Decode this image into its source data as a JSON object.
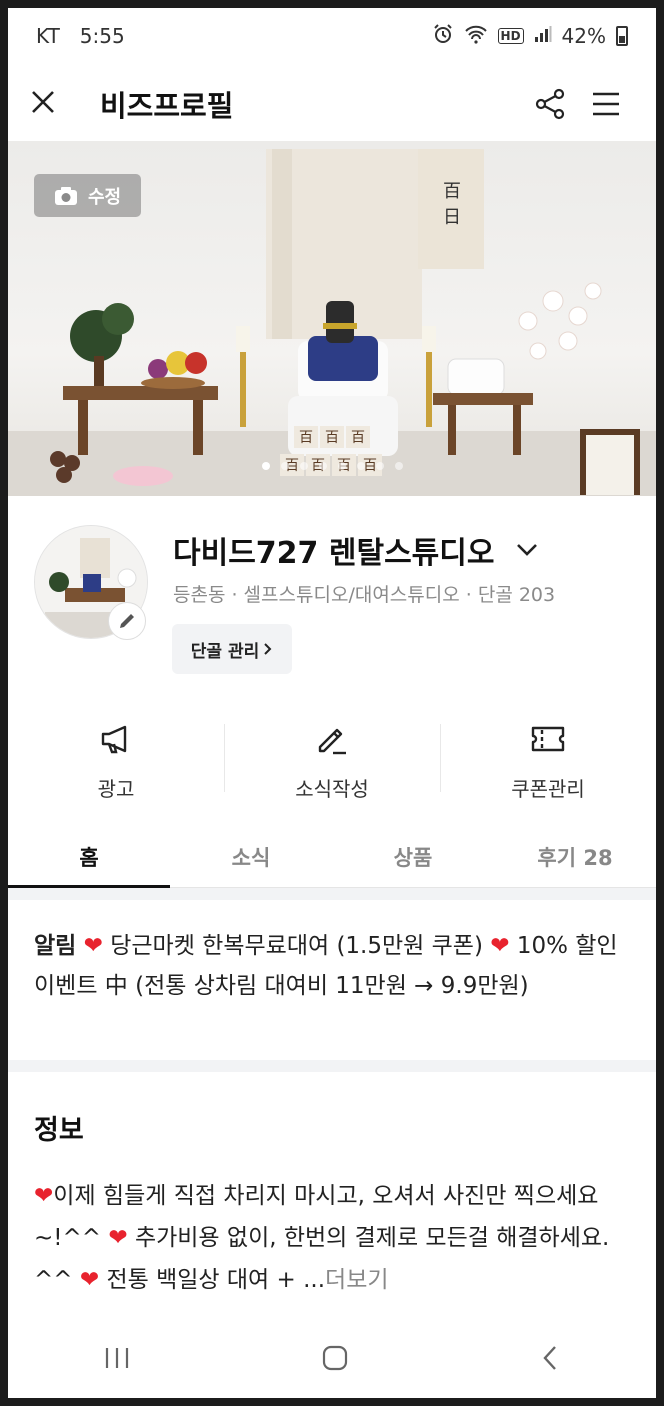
{
  "status_bar": {
    "carrier": "KT",
    "time": "5:55",
    "battery": "42%",
    "network_badge": "HD"
  },
  "header": {
    "title": "비즈프로필"
  },
  "hero": {
    "edit_label": "수정",
    "banner_text": "百 日",
    "slide_count": 8,
    "active_slide": 0
  },
  "profile": {
    "name": "다비드727 렌탈스튜디오",
    "meta": "등촌동 · 셀프스튜디오/대여스튜디오 · 단골 203",
    "regular_button": "단골 관리"
  },
  "actions": [
    {
      "label": "광고",
      "icon": "megaphone-icon"
    },
    {
      "label": "소식작성",
      "icon": "pencil-icon"
    },
    {
      "label": "쿠폰관리",
      "icon": "ticket-icon"
    }
  ],
  "tabs": [
    {
      "label": "홈",
      "active": true
    },
    {
      "label": "소식",
      "active": false
    },
    {
      "label": "상품",
      "active": false
    },
    {
      "label": "후기 28",
      "active": false
    }
  ],
  "notice": {
    "prefix": "알림",
    "part1": " 당근마켓 한복무료대여 (1.5만원 쿠폰) ",
    "part2": " 10% 할인 이벤트 中 (전통 상차림 대여비 11만원 → 9.9만원)"
  },
  "info": {
    "title": "정보",
    "part1": "이제 힘들게 직접 차리지 마시고, 오셔서 사진만 찍으세요~!^^ ",
    "part2": " 추가비용 없이, 한번의 결제로 모든걸 해결하세요. ^^ ",
    "part3": " 전통 백일상 대여 + ...",
    "more": "더보기"
  },
  "colors": {
    "accent_text": "#111111",
    "muted_text": "#8a8a8a",
    "heart": "#e8232e",
    "divider": "#f2f3f5"
  }
}
